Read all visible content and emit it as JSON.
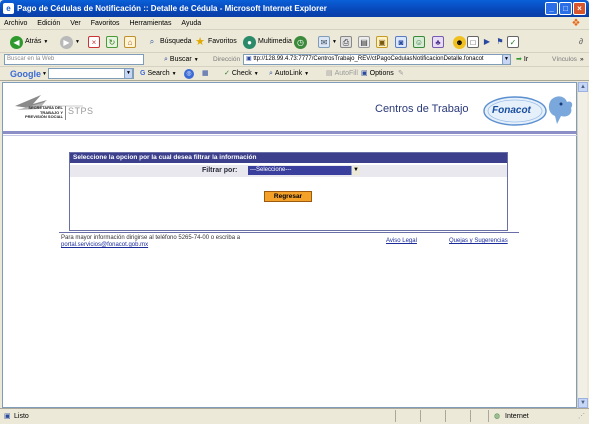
{
  "window": {
    "title": "Pago de Cédulas de Notificación :: Detalle de Cédula - Microsoft Internet Explorer"
  },
  "menu": [
    "Archivo",
    "Edición",
    "Ver",
    "Favoritos",
    "Herramientas",
    "Ayuda"
  ],
  "toolbar": {
    "back": "Atrás",
    "search": "Búsqueda",
    "favorites": "Favoritos",
    "media": "Multimedia"
  },
  "search_bar": {
    "placeholder": "Buscar en la Web",
    "button": "Buscar",
    "address_label": "Dirección",
    "url": "ttp://128.99.4.73:7777/CentrosTrabajo_REV/ctPagoCedulasNotificacionDetalle.fonacot",
    "go": "Ir",
    "links": "Vínculos"
  },
  "google_bar": {
    "brand": "Google",
    "search": "Search",
    "check": "Check",
    "autolink": "AutoLink",
    "autofill": "AutoFill",
    "options": "Options"
  },
  "header": {
    "org_line1": "SECRETARÍA DEL",
    "org_line2": "TRABAJO Y",
    "org_line3": "PREVISIÓN SOCIAL",
    "org_abbr": "STPS",
    "site_title": "Centros de Trabajo",
    "brand": "Fonacot"
  },
  "filter_panel": {
    "heading": "Seleccione la opcion por la cual desea filtrar la información",
    "label": "Filtrar por:",
    "selected": "---Seleccione---",
    "back_button": "Regresar"
  },
  "footer": {
    "line1": "Para mayor información dirigirse al teléfono 5265-74-00 o escriba a",
    "email": "portal.servicios@fonacot.gob.mx",
    "legal": "Aviso Legal",
    "suggestions": "Quejas y Sugerencias"
  },
  "status": {
    "left": "Listo",
    "zone": "Internet"
  }
}
